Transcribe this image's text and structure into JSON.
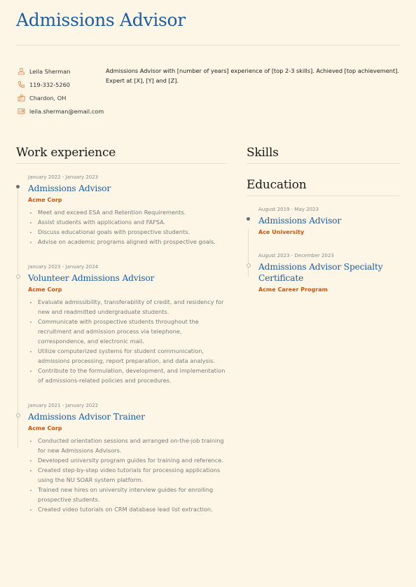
{
  "header": {
    "title": "Admissions Advisor"
  },
  "contact": [
    {
      "icon": "person-icon",
      "text": "Leila Sherman"
    },
    {
      "icon": "phone-icon",
      "text": "119-332-5260"
    },
    {
      "icon": "location-icon",
      "text": "Chardon, OH"
    },
    {
      "icon": "email-icon",
      "text": "leila.sherman@email.com"
    }
  ],
  "summary": "Admissions Advisor with [number of years] experience of [top 2-3 skills]. Achieved [top achievement]. Expert at [X], [Y] and [Z].",
  "colors": {
    "background": "#fdf6e6",
    "accent_blue": "#1f5c99",
    "accent_orange": "#c5560e",
    "icon_orange": "#e08a4f"
  },
  "work": {
    "heading": "Work experience",
    "entries": [
      {
        "date": "January 2022 - January 2023",
        "role": "Admissions Advisor",
        "company": "Acme Corp",
        "bullets": [
          "Meet and exceed ESA and Retention Requirements.",
          "Assist students with applications and FAFSA.",
          "Discuss educational goals with prospective students.",
          "Advise on academic programs aligned with prospective goals."
        ]
      },
      {
        "date": "January 2023 - January 2024",
        "role": "Volunteer Admissions Advisor",
        "company": "Acme Corp",
        "bullets": [
          "Evaluate admissibility, transferability of credit, and residency for new and readmitted undergraduate students.",
          "Communicate with prospective students throughout the recruitment and admission process via telephone, correspondence, and electronic mail.",
          "Utilize computerized systems for student communication, admissions processing, report preparation, and data analysis.",
          "Contribute to the formulation, development, and implementation of admissions-related policies and procedures."
        ]
      },
      {
        "date": "January 2021 - January 2022",
        "role": "Admissions Advisor Trainer",
        "company": "Acme Corp",
        "bullets": [
          "Conducted orientation sessions and arranged on-the-job training for new Admissions Advisors.",
          "Developed university program guides for training and reference.",
          "Created step-by-step video tutorials for processing applications using the NU SOAR system platform.",
          "Trained new hires on university interview guides for enrolling prospective students.",
          "Created video tutorials on CRM database lead list extraction."
        ]
      }
    ]
  },
  "skills": {
    "heading": "Skills"
  },
  "education": {
    "heading": "Education",
    "entries": [
      {
        "date": "August 2019 - May 2023",
        "role": "Admissions Advisor",
        "company": "Ace University"
      },
      {
        "date": "August 2023 - December 2023",
        "role": "Admissions Advisor Specialty Certificate",
        "company": "Acme Career Program"
      }
    ]
  }
}
